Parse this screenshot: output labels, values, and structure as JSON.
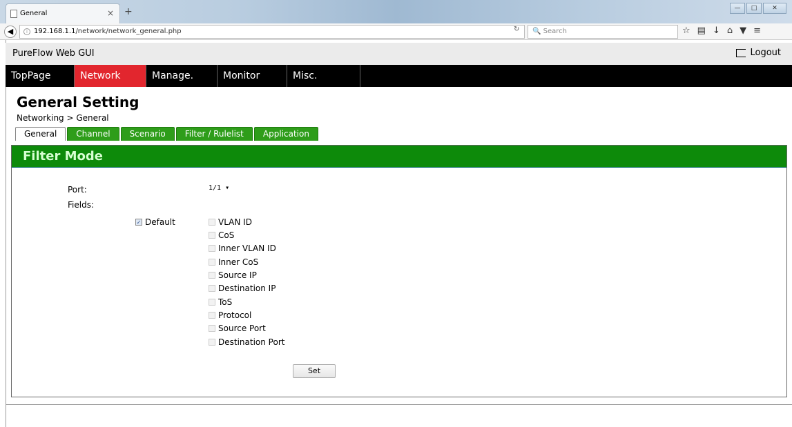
{
  "browser": {
    "tab_title": "General",
    "tab_close": "×",
    "new_tab": "+",
    "url_host": "192.168.1.1",
    "url_path": "/network/network_general.php",
    "search_placeholder": "Search",
    "toolbar_icons": [
      "star-icon",
      "reading-list-icon",
      "download-icon",
      "home-icon",
      "pocket-icon",
      "menu-icon"
    ]
  },
  "app": {
    "title": "PureFlow Web GUI",
    "logout_label": "Logout"
  },
  "menu": {
    "items": [
      {
        "label": "TopPage"
      },
      {
        "label": "Network"
      },
      {
        "label": "Manage."
      },
      {
        "label": "Monitor"
      },
      {
        "label": "Misc."
      }
    ],
    "active_color": "#e2262e"
  },
  "page": {
    "title": "General Setting",
    "breadcrumb": "Networking > General"
  },
  "subtabs": [
    {
      "label": "General"
    },
    {
      "label": "Channel"
    },
    {
      "label": "Scenario"
    },
    {
      "label": "Filter / Rulelist"
    },
    {
      "label": "Application"
    }
  ],
  "panel": {
    "title": "Filter Mode",
    "port_label": "Port:",
    "port_value": "1/1",
    "fields_label": "Fields:",
    "default_label": "Default",
    "default_checked": true,
    "fields": [
      {
        "label": "VLAN ID",
        "checked": false
      },
      {
        "label": "CoS",
        "checked": false
      },
      {
        "label": "Inner VLAN ID",
        "checked": false
      },
      {
        "label": "Inner CoS",
        "checked": false
      },
      {
        "label": "Source IP",
        "checked": false
      },
      {
        "label": "Destination IP",
        "checked": false
      },
      {
        "label": "ToS",
        "checked": false
      },
      {
        "label": "Protocol",
        "checked": false
      },
      {
        "label": "Source Port",
        "checked": false
      },
      {
        "label": "Destination Port",
        "checked": false
      }
    ],
    "set_label": "Set",
    "header_color": "#0d8a0a"
  }
}
